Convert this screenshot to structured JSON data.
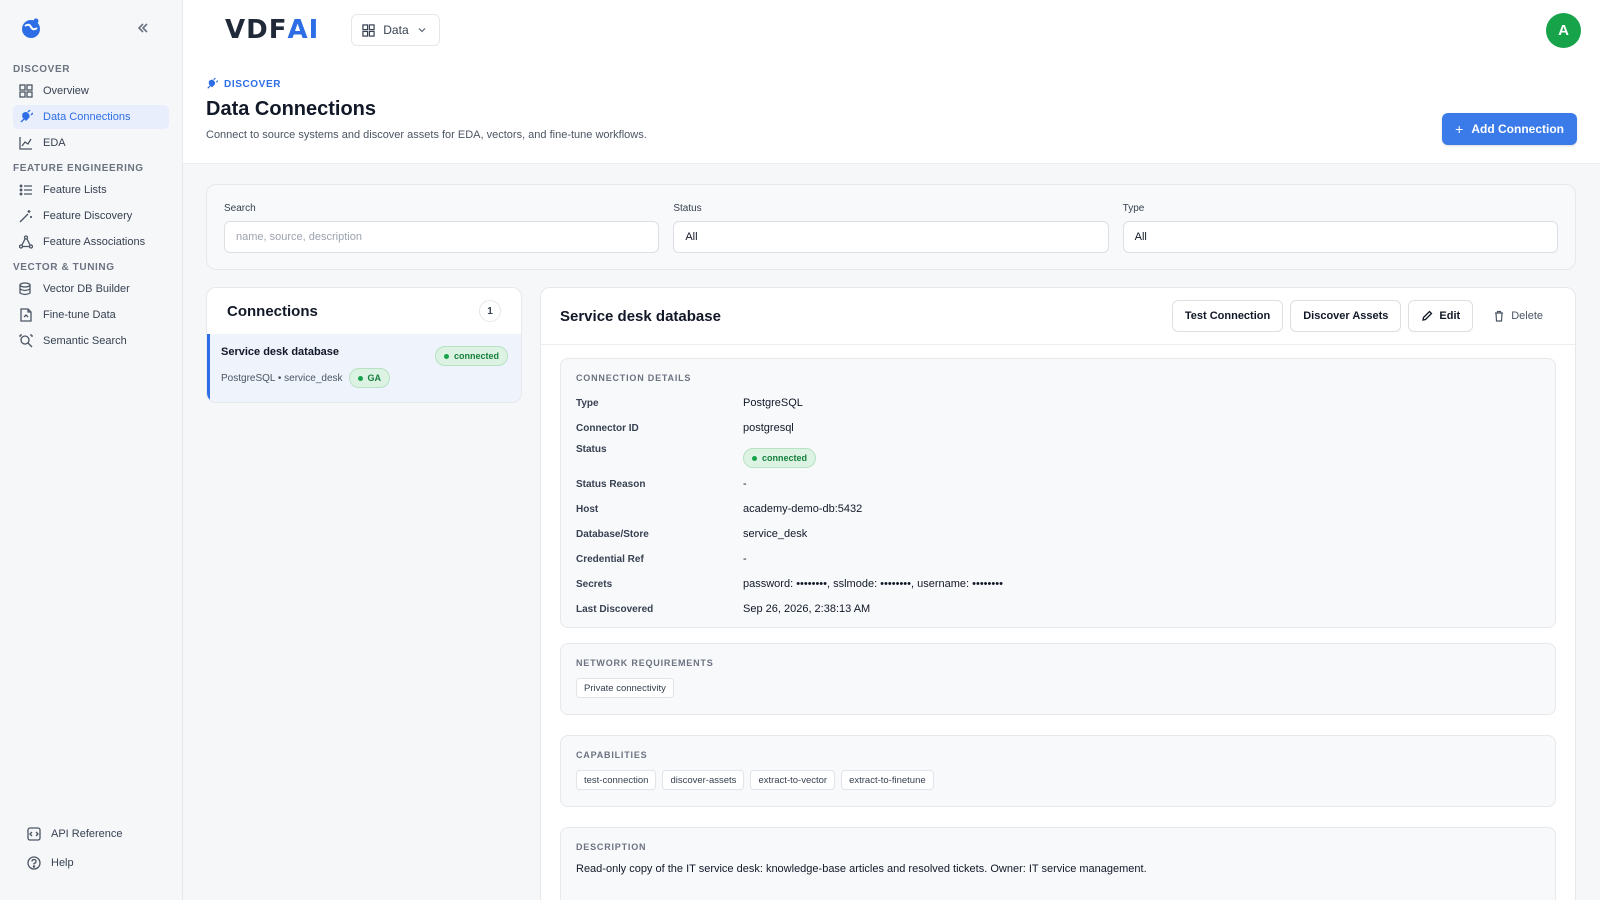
{
  "sidebar": {
    "sections": [
      {
        "title": "DISCOVER",
        "items": [
          {
            "label": "Overview",
            "icon": "grid-icon"
          },
          {
            "label": "Data Connections",
            "icon": "plug-icon",
            "active": true
          },
          {
            "label": "EDA",
            "icon": "chart-icon"
          }
        ]
      },
      {
        "title": "FEATURE ENGINEERING",
        "items": [
          {
            "label": "Feature Lists",
            "icon": "list-icon"
          },
          {
            "label": "Feature Discovery",
            "icon": "wand-icon"
          },
          {
            "label": "Feature Associations",
            "icon": "network-icon"
          }
        ]
      },
      {
        "title": "VECTOR & TUNING",
        "items": [
          {
            "label": "Vector DB Builder",
            "icon": "database-icon"
          },
          {
            "label": "Fine-tune Data",
            "icon": "file-icon"
          },
          {
            "label": "Semantic Search",
            "icon": "search-icon"
          }
        ]
      }
    ],
    "bottom": [
      {
        "label": "API Reference",
        "icon": "api-icon"
      },
      {
        "label": "Help",
        "icon": "help-icon"
      }
    ]
  },
  "topbar": {
    "brand_main": "VDF",
    "brand_accent": "AI",
    "app_switch_label": "Data",
    "avatar_initial": "A"
  },
  "header": {
    "crumb": "DISCOVER",
    "title": "Data Connections",
    "subtitle": "Connect to source systems and discover assets for EDA, vectors, and fine-tune workflows.",
    "add_button": "Add Connection"
  },
  "filters": {
    "search_label": "Search",
    "search_placeholder": "name, source, description",
    "status_label": "Status",
    "status_value": "All",
    "type_label": "Type",
    "type_value": "All"
  },
  "connections": {
    "title": "Connections",
    "count": "1",
    "items": [
      {
        "name": "Service desk database",
        "meta": "PostgreSQL • service_desk",
        "status": "connected",
        "stage": "GA"
      }
    ]
  },
  "detail": {
    "title": "Service desk database",
    "actions": {
      "test": "Test Connection",
      "discover": "Discover Assets",
      "edit": "Edit",
      "delete": "Delete"
    },
    "details_heading": "CONNECTION DETAILS",
    "details": {
      "type": {
        "k": "Type",
        "v": "PostgreSQL"
      },
      "connector": {
        "k": "Connector ID",
        "v": "postgresql"
      },
      "status": {
        "k": "Status",
        "v": "connected"
      },
      "reason": {
        "k": "Status Reason",
        "v": "-"
      },
      "host": {
        "k": "Host",
        "v": "academy-demo-db:5432"
      },
      "db": {
        "k": "Database/Store",
        "v": "service_desk"
      },
      "cred": {
        "k": "Credential Ref",
        "v": "-"
      },
      "secrets": {
        "k": "Secrets",
        "v": "password: ••••••••, sslmode: ••••••••, username: ••••••••"
      },
      "last": {
        "k": "Last Discovered",
        "v": "Sep 26, 2026, 2:38:13 AM"
      }
    },
    "network_heading": "NETWORK REQUIREMENTS",
    "network": [
      "Private connectivity"
    ],
    "capabilities_heading": "CAPABILITIES",
    "capabilities": [
      "test-connection",
      "discover-assets",
      "extract-to-vector",
      "extract-to-finetune"
    ],
    "description_heading": "DESCRIPTION",
    "description": "Read-only copy of the IT service desk: knowledge-base articles and resolved tickets. Owner: IT service management."
  },
  "colors": {
    "accent": "#2d6ee6",
    "success": "#16a34a",
    "button": "#3b7be9"
  }
}
